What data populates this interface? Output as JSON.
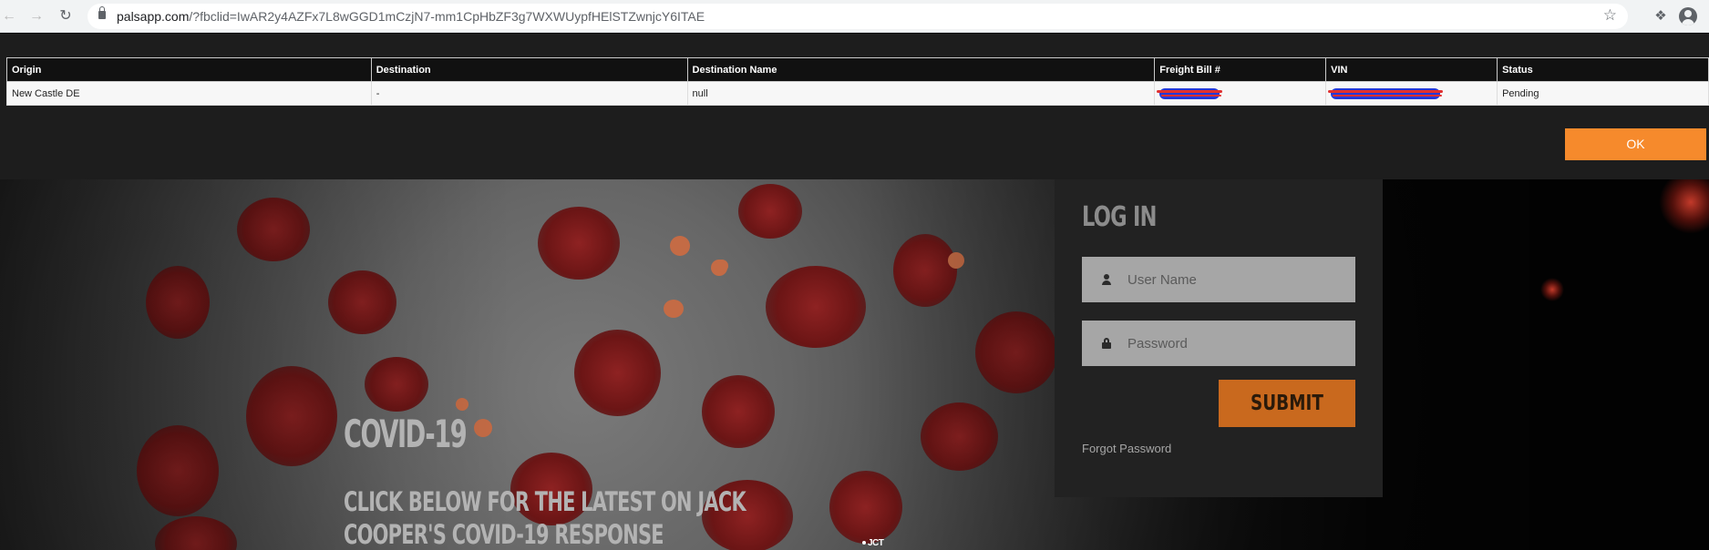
{
  "browser": {
    "url_host": "palsapp.com",
    "url_path": "/?fbclid=IwAR2y4AZFx7L8wGGD1mCzjN7-mm1CpHbZF3g7WXWUypfHElSTZwnjcY6ITAE",
    "icons": {
      "back": "arrow-left-icon",
      "forward": "arrow-right-icon",
      "reload": "reload-icon",
      "secure": "lock-icon",
      "bookmark": "star-icon",
      "extensions": "puzzle-icon",
      "profile": "profile-icon"
    }
  },
  "results_table": {
    "headers": [
      "Origin",
      "Destination",
      "Destination Name",
      "Freight Bill #",
      "VIN",
      "Status"
    ],
    "row": {
      "origin": "New Castle DE",
      "destination": "-",
      "destination_name": "null",
      "status": "Pending"
    }
  },
  "ok_button": "OK",
  "hero": {
    "title": "COVID-19",
    "subtitle": "CLICK BELOW FOR THE LATEST ON JACK COOPER'S COVID-19 RESPONSE",
    "logo_text": "JCT"
  },
  "login": {
    "title": "LOG IN",
    "username_placeholder": "User Name",
    "password_placeholder": "Password",
    "submit_label": "SUBMIT",
    "forgot_label": "Forgot Password"
  },
  "colors": {
    "accent_orange": "#f68a2c",
    "submit_orange": "#c9691e",
    "panel_dark": "#222222",
    "redaction_blue": "#2438d8",
    "redaction_red": "#e03030"
  }
}
